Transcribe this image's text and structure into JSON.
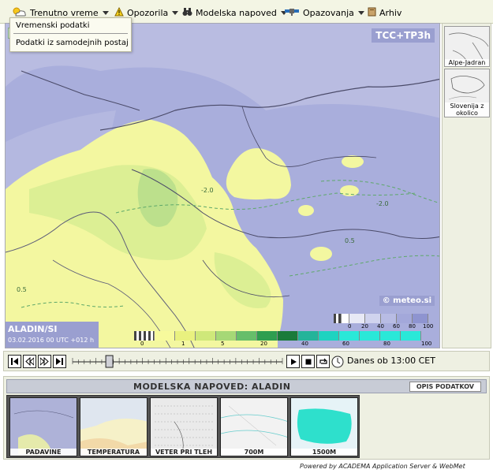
{
  "menu": {
    "items": [
      {
        "label": "Trenutno vreme"
      },
      {
        "label": "Opozorila"
      },
      {
        "label": "Modelska napoved"
      },
      {
        "label": "Opazovanja"
      },
      {
        "label": "Arhiv"
      }
    ],
    "dropdown": [
      "Vremenski podatki",
      "Podatki iz samodejnih postaj"
    ]
  },
  "map": {
    "product_label": "TCC+TP3h",
    "copyright": "© meteo.si",
    "model": "ALADIN/SI",
    "run_time": "03.02.2016 00 UTC +012 h",
    "contour_labels": [
      "-2.0",
      "-2.0",
      "0.5",
      "0.5"
    ],
    "colors": {
      "cloud_purple": "#a9aedc",
      "cloud_light": "#c6c9e6",
      "precip_yellow": "#f3f7a0",
      "precip_light_green": "#dcef94",
      "precip_green": "#bce08c"
    }
  },
  "legend_cloud": {
    "labels": [
      "0",
      "20",
      "40",
      "60",
      "80",
      "100"
    ],
    "colors": [
      "#444444",
      "#ffffff",
      "#e8e9f5",
      "#d0d3ee",
      "#b8bce4",
      "#a3a8da",
      "#8e94d0"
    ]
  },
  "legend_precip": {
    "labels": [
      "0",
      "1",
      "5",
      "20",
      "40",
      "60",
      "80",
      "100"
    ],
    "colors": [
      "#555555",
      "#f7fa9c",
      "#e9f17f",
      "#cfe87a",
      "#a6d876",
      "#67be6a",
      "#2f9e4f",
      "#1a7b3a",
      "#24b49a",
      "#1ed3c0",
      "#2ae8d8"
    ]
  },
  "side_thumbs": [
    {
      "label": "Alpe-Jadran"
    },
    {
      "label": "Slovenija z okolico"
    }
  ],
  "player": {
    "time_label": "Danes ob 13:00 CET",
    "position": 0.1
  },
  "gallery": {
    "title": "MODELSKA NAPOVED: ALADIN",
    "opis_label": "OPIS PODATKOV",
    "thumbs": [
      {
        "label": "PADAVINE",
        "bg": "#aeb2d8"
      },
      {
        "label": "TEMPERATURA",
        "bg": "#f6f1c8"
      },
      {
        "label": "VETER PRI TLEH",
        "bg": "#eaeaea"
      },
      {
        "label": "700M",
        "bg": "#f2f2f2"
      },
      {
        "label": "1500M",
        "bg": "#e6f3f7"
      }
    ]
  },
  "footer": {
    "powered": "Powered by ACADEMA Application Server & WebMet"
  }
}
